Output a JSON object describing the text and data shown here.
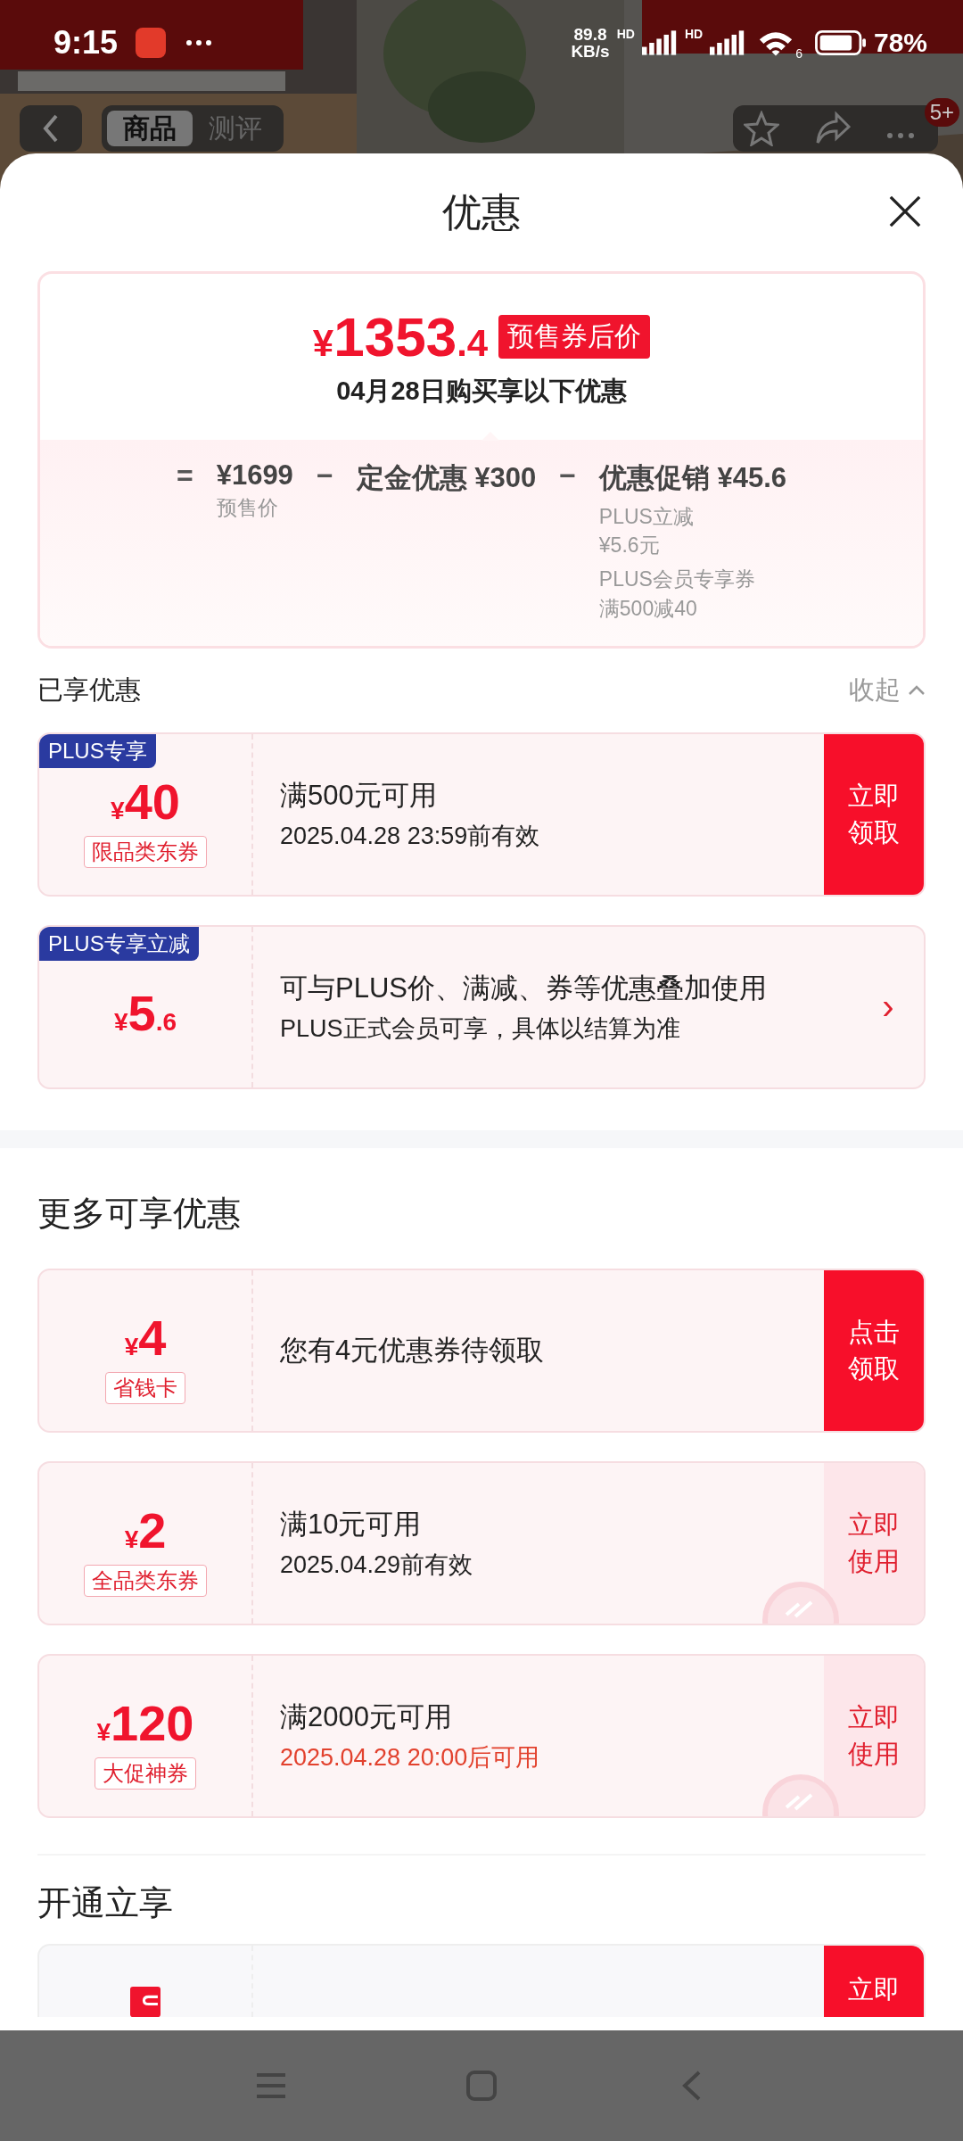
{
  "status_bar": {
    "time": "9:15",
    "net_speed": "89.8",
    "net_unit": "KB/s",
    "signal_labels": [
      "HD",
      "HD"
    ],
    "wifi_label": "6",
    "battery": "78%"
  },
  "background_page": {
    "tabs": [
      {
        "label": "商品",
        "selected": true
      },
      {
        "label": "测评",
        "selected": false
      }
    ],
    "badge": "5+"
  },
  "sheet": {
    "title": "优惠"
  },
  "summary": {
    "currency": "¥",
    "price": "1353",
    "price_decimal": ".4",
    "price_tag": "预售券后价",
    "subtitle": "04月28日购买享以下优惠",
    "equation": [
      {
        "kind": "op",
        "text": "="
      },
      {
        "kind": "term",
        "value": "¥1699",
        "label": "预售价"
      },
      {
        "kind": "op",
        "text": "−"
      },
      {
        "kind": "term",
        "value": "定金优惠 ¥300"
      },
      {
        "kind": "op",
        "text": "−"
      },
      {
        "kind": "term",
        "value": "优惠促销 ¥45.6",
        "details": [
          {
            "name": "PLUS立减",
            "amount": "¥5.6元"
          },
          {
            "name": "PLUS会员专享券",
            "amount": "满500减40"
          }
        ]
      }
    ]
  },
  "applied": {
    "title": "已享优惠",
    "toggle": "收起",
    "expanded": true,
    "coupons": [
      {
        "ribbon": "PLUS专享",
        "currency": "¥",
        "amount": "40",
        "tag": "限品类东券",
        "title": "满500元可用",
        "subtitle": "2025.04.28 23:59前有效",
        "subtitle_alert": false,
        "action": {
          "kind": "solid",
          "text": "立即领取"
        }
      },
      {
        "ribbon": "PLUS专享立减",
        "currency": "¥",
        "amount": "5",
        "decimal": ".6",
        "title": "可与PLUS价、满减、券等优惠叠加使用",
        "subtitle": "PLUS正式会员可享，具体以结算为准",
        "subtitle_alert": false,
        "action": {
          "kind": "arrow",
          "text": "›"
        }
      }
    ]
  },
  "more": {
    "title": "更多可享优惠",
    "coupons": [
      {
        "currency": "¥",
        "amount": "4",
        "tag": "省钱卡",
        "title": "您有4元优惠券待领取",
        "action": {
          "kind": "solid",
          "text": "点击领取"
        }
      },
      {
        "currency": "¥",
        "amount": "2",
        "tag": "全品类东券",
        "title": "满10元可用",
        "subtitle": "2025.04.29前有效",
        "subtitle_alert": false,
        "claimed": true,
        "action": {
          "kind": "soft",
          "text": "立即使用"
        }
      },
      {
        "currency": "¥",
        "amount": "120",
        "tag": "大促神券",
        "title": "满2000元可用",
        "subtitle": "2025.04.28 20:00后可用",
        "subtitle_alert": true,
        "claimed": true,
        "action": {
          "kind": "soft",
          "text": "立即使用"
        }
      }
    ]
  },
  "membership": {
    "title": "开通立享",
    "card": {
      "action": "立即"
    }
  }
}
